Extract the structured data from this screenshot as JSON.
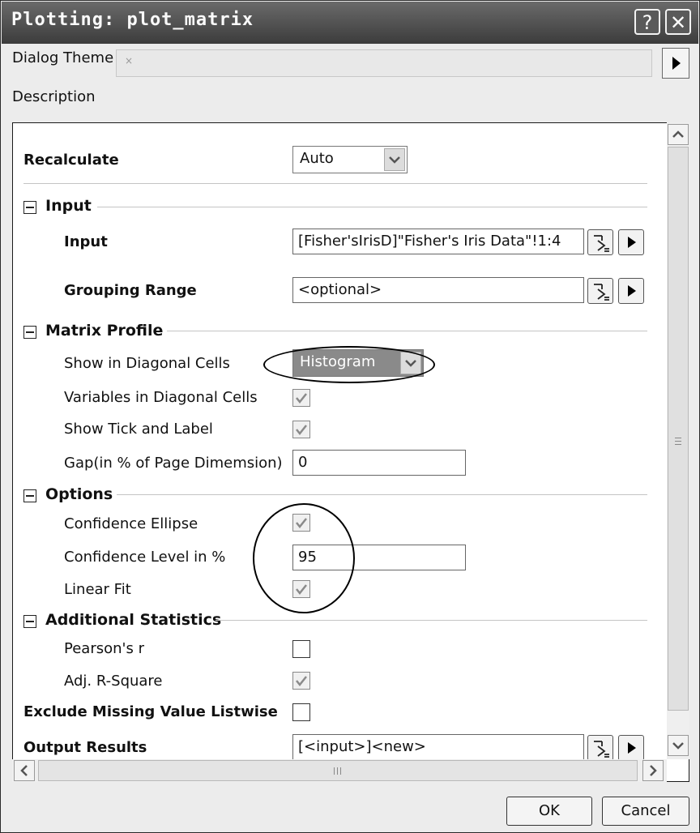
{
  "window": {
    "title": "Plotting: plot_matrix",
    "help_glyph": "?",
    "close_glyph": "✕"
  },
  "theme": {
    "label": "Dialog Theme",
    "value": "×",
    "arrow_icon": "right-triangle-icon"
  },
  "description_label": "Description",
  "recalculate": {
    "label": "Recalculate",
    "value": "Auto"
  },
  "sections": {
    "input": {
      "title": "Input",
      "input_label": "Input",
      "input_value": "[Fisher'sIrisD]\"Fisher's Iris Data\"!1:4",
      "grouping_label": "Grouping Range",
      "grouping_value": "<optional>"
    },
    "matrix_profile": {
      "title": "Matrix Profile",
      "diag_label": "Show in Diagonal Cells",
      "diag_value": "Histogram",
      "vars_label": "Variables in Diagonal Cells",
      "vars_checked": true,
      "tick_label": "Show Tick and Label",
      "tick_checked": true,
      "gap_label": "Gap(in % of Page Dimemsion)",
      "gap_value": "0"
    },
    "options": {
      "title": "Options",
      "ellipse_label": "Confidence Ellipse",
      "ellipse_checked": true,
      "level_label": "Confidence Level in %",
      "level_value": "95",
      "fit_label": "Linear Fit",
      "fit_checked": true
    },
    "additional_statistics": {
      "title": "Additional Statistics",
      "pearson_label": "Pearson's r",
      "pearson_checked": false,
      "adjr_label": "Adj. R-Square",
      "adjr_checked": true
    }
  },
  "exclude_missing": {
    "label": "Exclude Missing Value Listwise",
    "checked": false
  },
  "output_results": {
    "label": "Output Results",
    "value": "[<input>]<new>"
  },
  "buttons": {
    "ok": "OK",
    "cancel": "Cancel"
  },
  "icons": {
    "range_select": "range-select-icon",
    "flyout": "right-triangle-icon",
    "checkmark": "checkmark-icon"
  }
}
